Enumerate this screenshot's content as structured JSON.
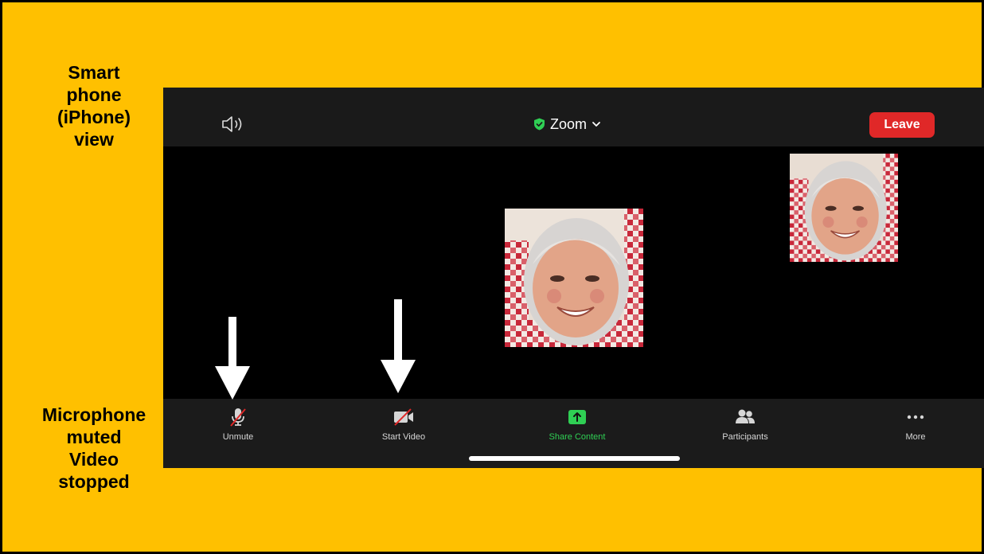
{
  "annotations": {
    "top_lines": [
      "Smart",
      "phone",
      "(iPhone)",
      "view"
    ],
    "bottom_lines": [
      "Microphone",
      "muted",
      "Video",
      "stopped"
    ]
  },
  "header": {
    "speaker_icon": "speaker-icon",
    "title": "Zoom",
    "title_icon": "green-shield-icon",
    "dropdown_icon": "chevron-down-icon",
    "leave_label": "Leave"
  },
  "video": {
    "main_tile": "participant-video",
    "self_tile": "self-video"
  },
  "toolbar": {
    "items": [
      {
        "label": "Unmute",
        "icon": "mic-muted-icon"
      },
      {
        "label": "Start Video",
        "icon": "video-off-icon"
      },
      {
        "label": "Share Content",
        "icon": "share-screen-icon"
      },
      {
        "label": "Participants",
        "icon": "participants-icon"
      },
      {
        "label": "More",
        "icon": "more-icon"
      }
    ]
  },
  "colors": {
    "background": "#FFC000",
    "leave": "#E02828",
    "share": "#2FCF54",
    "strike": "#E02828"
  }
}
